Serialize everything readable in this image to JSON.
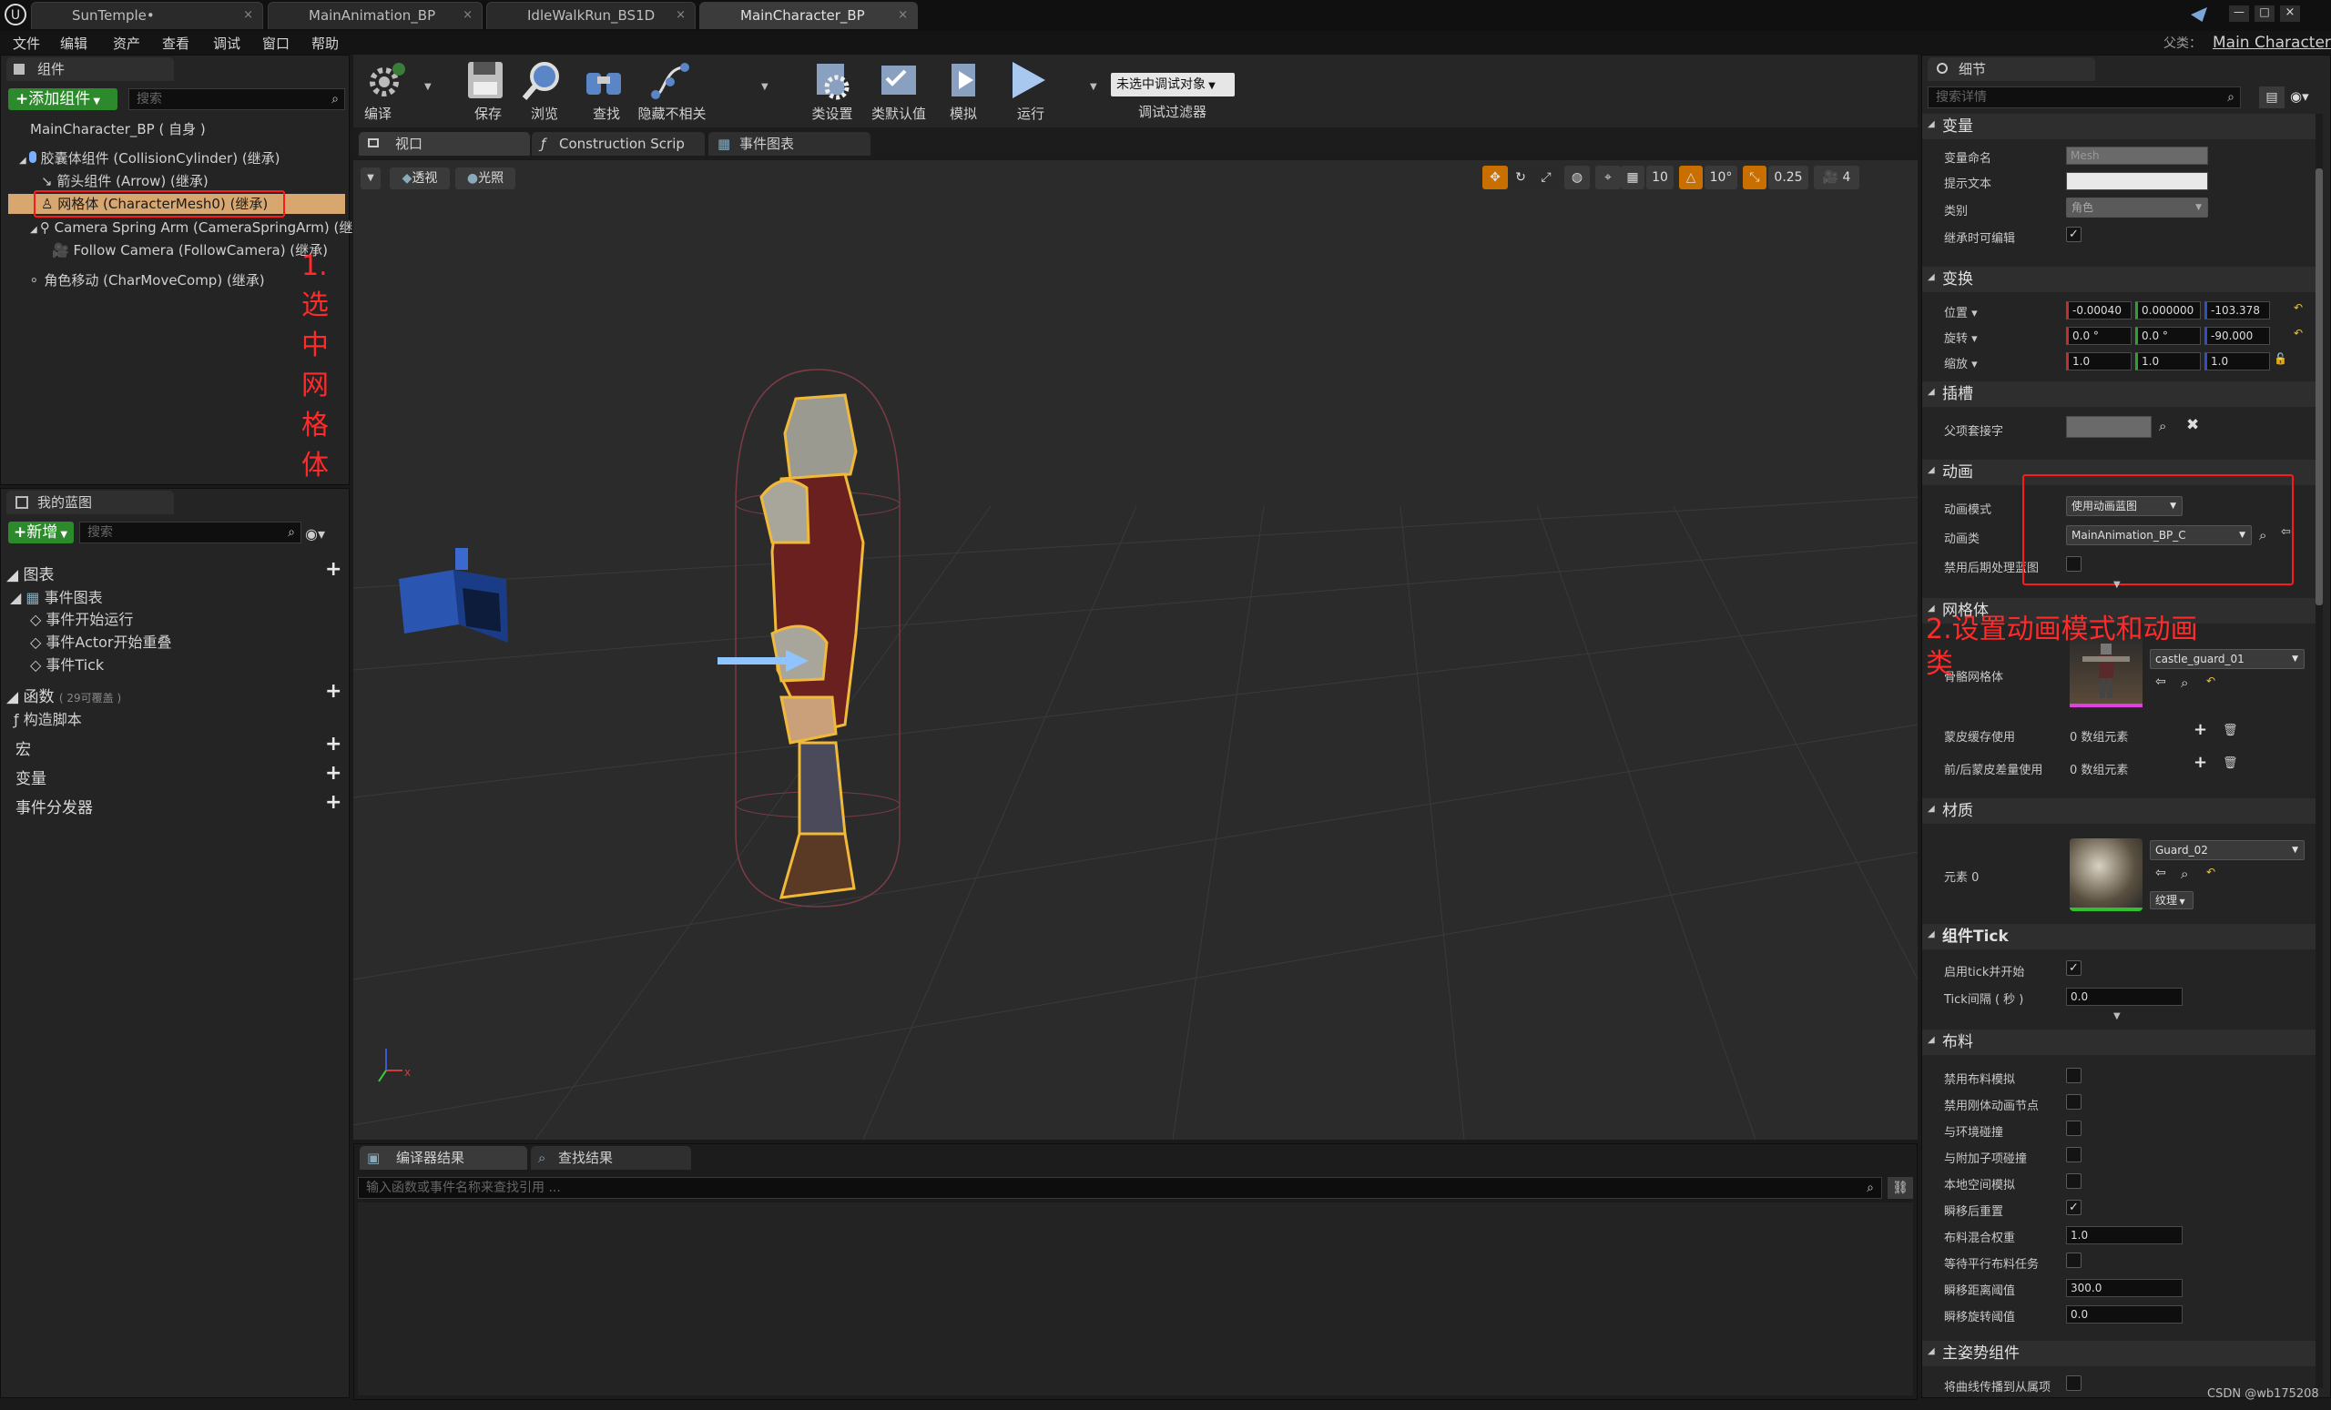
{
  "title_tabs": [
    {
      "label": "SunTemple•"
    },
    {
      "label": "MainAnimation_BP"
    },
    {
      "label": "IdleWalkRun_BS1D"
    },
    {
      "label": "MainCharacter_BP"
    }
  ],
  "menu": [
    "文件",
    "编辑",
    "资产",
    "查看",
    "调试",
    "窗口",
    "帮助"
  ],
  "parent_class": {
    "label": "父类：",
    "value": "Main Character"
  },
  "components_panel": {
    "tab": "组件",
    "add_button": "添加组件",
    "search_placeholder": "搜索",
    "root": "MainCharacter_BP ( 自身 )",
    "items": [
      "胶囊体组件 (CollisionCylinder) (继承)",
      "箭头组件 (Arrow) (继承)",
      "网格体 (CharacterMesh0) (继承)",
      "Camera Spring Arm (CameraSpringArm) (继承)",
      "Follow Camera (FollowCamera) (继承)",
      "角色移动 (CharMoveComp) (继承)"
    ],
    "annotation": "1.选中网格体"
  },
  "my_blueprint": {
    "tab": "我的蓝图",
    "new_button": "新增",
    "search_placeholder": "搜索",
    "graphs_label": "图表",
    "event_graph": "事件图表",
    "events": [
      "事件开始运行",
      "事件Actor开始重叠",
      "事件Tick"
    ],
    "functions_label": "函数",
    "functions_note": "( 29可覆盖 )",
    "construction_script": "构造脚本",
    "macros": "宏",
    "variables": "变量",
    "dispatchers": "事件分发器"
  },
  "toolbar": {
    "compile": "编译",
    "save": "保存",
    "browse": "浏览",
    "find": "查找",
    "hide_unrelated": "隐藏不相关",
    "class_settings": "类设置",
    "class_defaults": "类默认值",
    "simulate": "模拟",
    "play": "运行",
    "debug_select": "未选中调试对象",
    "debug_filter": "调试过滤器"
  },
  "editor_tabs": [
    "视口",
    "Construction Scrip",
    "事件图表"
  ],
  "viewport": {
    "perspective": "透视",
    "lit": "光照",
    "grid_snap": "10",
    "rot_snap": "10°",
    "scale_snap": "0.25",
    "cam_speed": "4"
  },
  "bottom_panel": {
    "tabs": [
      "编译器结果",
      "查找结果"
    ],
    "search_placeholder": "输入函数或事件名称来查找引用 ..."
  },
  "details": {
    "tab": "细节",
    "search_placeholder": "搜索详情",
    "variable_section": "变量",
    "var_name_label": "变量命名",
    "var_name": "Mesh",
    "tooltip_label": "提示文本",
    "category_label": "类别",
    "category": "角色",
    "editable_label": "继承时可编辑",
    "transform_section": "变换",
    "location_label": "位置",
    "location": [
      "-0.00040",
      "0.000000",
      "-103.378"
    ],
    "rotation_label": "旋转",
    "rotation": [
      "0.0 °",
      "0.0 °",
      "-90.000"
    ],
    "scale_label": "缩放",
    "scale": [
      "1.0",
      "1.0",
      "1.0"
    ],
    "sockets_section": "插槽",
    "parent_socket_label": "父项套接字",
    "animation_section": "动画",
    "anim_mode_label": "动画模式",
    "anim_mode": "使用动画蓝图",
    "anim_class_label": "动画类",
    "anim_class": "MainAnimation_BP_C",
    "disable_post_label": "禁用后期处理蓝图",
    "mesh_section": "网格体",
    "skeletal_mesh_label": "骨骼网格体",
    "skeletal_mesh": "castle_guard_01",
    "skin_cache_label": "蒙皮缓存使用",
    "skin_cache": "0 数组元素",
    "pre_skin_label": "前/后蒙皮差量使用",
    "pre_skin": "0 数组元素",
    "materials_section": "材质",
    "element0_label": "元素 0",
    "element0": "Guard_02",
    "texture_btn": "纹理",
    "tick_section": "组件Tick",
    "tick_start_label": "启用tick并开始",
    "tick_interval_label": "Tick间隔 ( 秒 )",
    "tick_interval": "0.0",
    "cloth_section": "布料",
    "cloth_rows": [
      "禁用布料模拟",
      "禁用刚体动画节点",
      "与环境碰撞",
      "与附加子项碰撞",
      "本地空间模拟",
      "瞬移后重置",
      "布料混合权重",
      "等待平行布料任务",
      "瞬移距离阈值",
      "瞬移旋转阈值"
    ],
    "cloth_blend": "1.0",
    "teleport_dist": "300.0",
    "teleport_rot": "0.0",
    "master_pose_section": "主姿势组件",
    "master_pose_row": "将曲线传播到从属项",
    "annotation": "2.设置动画模式和动画类"
  },
  "watermark": "CSDN @wb175208"
}
